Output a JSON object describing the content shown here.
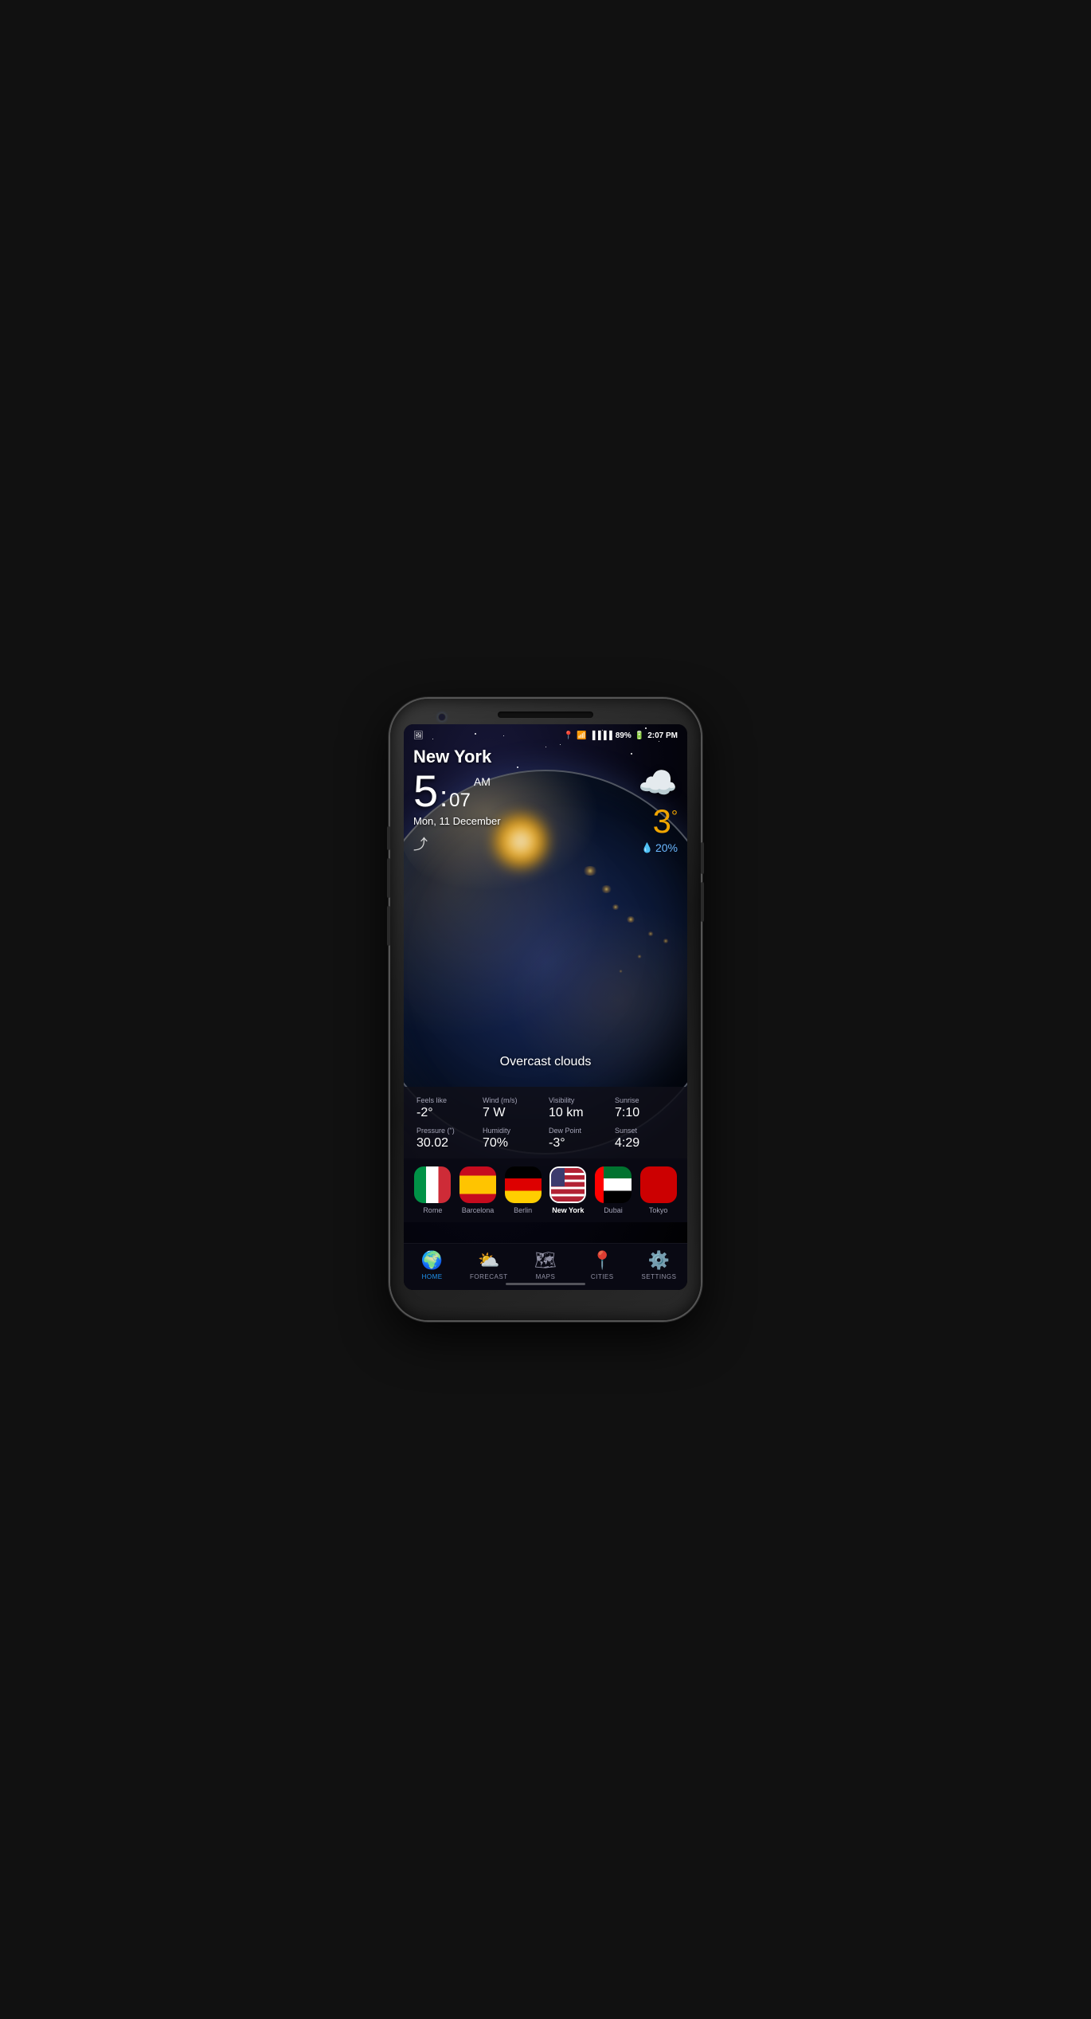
{
  "phone": {
    "status_bar": {
      "battery": "89%",
      "time": "2:07 PM",
      "signal_icon": "📶",
      "wifi_icon": "📡",
      "location_icon": "📍"
    }
  },
  "weather": {
    "city": "New York",
    "time_hour": "5",
    "time_minute": "07",
    "time_ampm": "AM",
    "date": "Mon, 11 December",
    "temperature": "3",
    "temperature_unit": "°",
    "precipitation": "20%",
    "condition": "Overcast clouds",
    "feels_like_label": "Feels like",
    "feels_like_value": "-2°",
    "wind_label": "Wind (m/s)",
    "wind_value": "7 W",
    "visibility_label": "Visibility",
    "visibility_value": "10 km",
    "sunrise_label": "Sunrise",
    "sunrise_value": "7:10",
    "pressure_label": "Pressure (\")",
    "pressure_value": "30.02",
    "humidity_label": "Humidity",
    "humidity_value": "70%",
    "dew_point_label": "Dew Point",
    "dew_point_value": "-3°",
    "sunset_label": "Sunset",
    "sunset_value": "4:29"
  },
  "cities": [
    {
      "name": "Rome",
      "flag": "🇮🇹",
      "selected": false
    },
    {
      "name": "Barcelona",
      "flag": "🇪🇸",
      "selected": false
    },
    {
      "name": "Berlin",
      "flag": "🇩🇪",
      "selected": false
    },
    {
      "name": "New York",
      "flag": "🇺🇸",
      "selected": true
    },
    {
      "name": "Dubai",
      "flag": "🇦🇪",
      "selected": false
    },
    {
      "name": "Tokyo",
      "flag": "🇯🇵",
      "selected": false
    }
  ],
  "nav": [
    {
      "id": "home",
      "label": "HOME",
      "icon": "🌍",
      "active": true
    },
    {
      "id": "forecast",
      "label": "FORECAST",
      "icon": "⛅",
      "active": false
    },
    {
      "id": "maps",
      "label": "MAPS",
      "icon": "🗺",
      "active": false
    },
    {
      "id": "cities",
      "label": "CITIES",
      "icon": "📍",
      "active": false
    },
    {
      "id": "settings",
      "label": "SETTINGS",
      "icon": "⚙",
      "active": false
    }
  ]
}
